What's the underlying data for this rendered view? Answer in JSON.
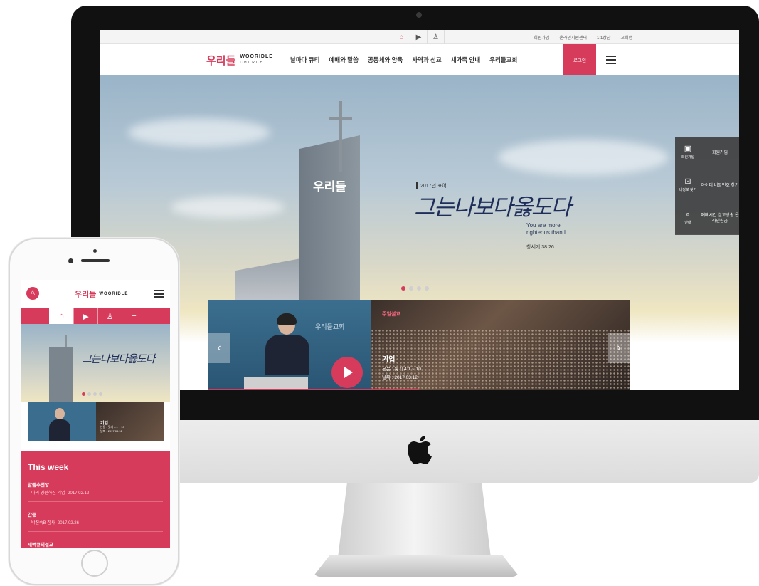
{
  "utility_bar": {
    "icons": [
      "home-icon",
      "video-icon",
      "user-icon"
    ],
    "links": [
      "회원가입",
      "온라인지원센터",
      "1:1상담",
      "교회맵"
    ]
  },
  "header": {
    "logo_mark": "우리들",
    "logo_title": "WOORIDLE",
    "logo_subtitle": "CHURCH",
    "menu": [
      "날마다 큐티",
      "예배와 말씀",
      "공동체와 양육",
      "사역과 선교",
      "새가족 안내",
      "우리들교회"
    ],
    "login_label": "로그인"
  },
  "hero": {
    "year_label": "2017년 표어",
    "calligraphy": "그는나보다옳도다",
    "english": "You are more righteous than I",
    "reference": "창세기 38:26",
    "slide_count": 4,
    "active_slide": 1,
    "tower_badge": "우리들"
  },
  "side_menu": [
    {
      "icon": "monitor-icon",
      "icon_label": "회원가입",
      "label": "회원가입"
    },
    {
      "icon": "id-card-icon",
      "icon_label": "내정보 찾기",
      "label": "아이디 비밀번호 찾기"
    },
    {
      "icon": "search-icon",
      "icon_label": "안내",
      "label": "예배시간 설교방송 온라인헌금"
    }
  ],
  "video": {
    "sign": "우리들교회",
    "tag": "주일설교",
    "title": "기업",
    "text": "본문 : 룻기 4:1 ~ 10",
    "date": "날짜 : 2017.03.12"
  },
  "phone": {
    "logo_mark": "우리들",
    "logo_title": "WOORIDLE",
    "tabs": [
      "home-icon",
      "video-icon",
      "user-icon",
      "plus-icon"
    ],
    "calligraphy": "그는나보다옳도다",
    "video_title": "기업",
    "video_text": "본문 : 룻기 4:1 ~ 10",
    "video_date": "날짜 : 2017.03.12",
    "week_title": "This week",
    "week_items": [
      {
        "title": "말씀추천양",
        "sub": "나의 영원하신 기업 -2017.02.12"
      },
      {
        "title": "간증",
        "sub": "박진숙B 집사 -2017.02.26"
      },
      {
        "title": "새벽큐티설교",
        "sub": ""
      }
    ]
  },
  "colors": {
    "accent": "#d63b5b",
    "side_menu_bg": "#3c3c3c"
  }
}
